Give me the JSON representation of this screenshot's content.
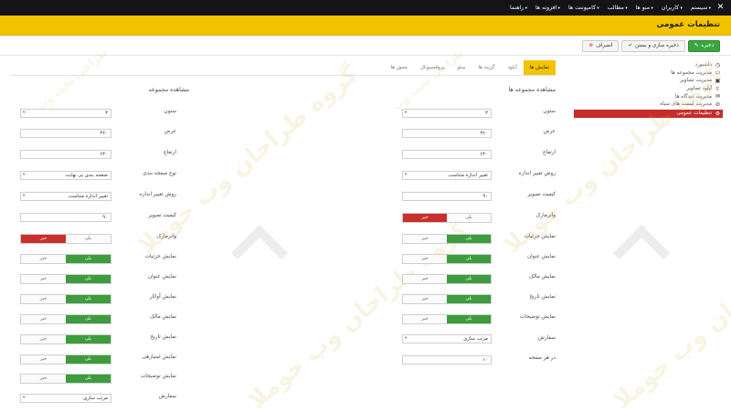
{
  "topbar": {
    "menu": [
      "سیستم",
      "کاربران",
      "منو ها",
      "مطالب",
      "کامپوننت ها",
      "افزونه ها",
      "راهنما"
    ]
  },
  "page": {
    "title": "تنظیمات عمومی"
  },
  "toolbar": {
    "save": "ذخیره",
    "save_close": "ذخیره سازی و بستن",
    "cancel": "انصراف"
  },
  "sidebar": {
    "items": [
      {
        "icon": "dashboard-icon",
        "label": "داشبورد"
      },
      {
        "icon": "folder-icon",
        "label": "مدیریت مجموعه ها"
      },
      {
        "icon": "images-icon",
        "label": "مدیریت تصاویر"
      },
      {
        "icon": "upload-icon",
        "label": "آپلود تصاویر"
      },
      {
        "icon": "comments-icon",
        "label": "مدیریت دیدگاه ها"
      },
      {
        "icon": "ban-icon",
        "label": "مدیریت لیست های سیاه"
      },
      {
        "icon": "settings-icon",
        "label": "تنظیمات عمومی"
      }
    ]
  },
  "tabs": [
    "نمایش ها",
    "آپلود",
    "گزینه ها",
    "سئو",
    "پروفسیونال",
    "مجوز ها"
  ],
  "left_col": {
    "heading": "مشاهده مجموعه",
    "fields": {
      "columns": {
        "label": "ستون",
        "value": "۳"
      },
      "width": {
        "label": "عرض",
        "value": "۳۶۰"
      },
      "height": {
        "label": "ارتفاع",
        "value": "۶۴۰"
      },
      "pagination": {
        "label": "نوع صفحه بندی",
        "value": "صفحه بندی بی نهایت"
      },
      "resize": {
        "label": "روش تغییر اندازه",
        "value": "تغییر اندازه متناسب"
      },
      "quality": {
        "label": "کیفیت تصویر",
        "value": "۹۰"
      },
      "watermark": {
        "label": "واترمارک",
        "yes": "بلی",
        "no": "خیر"
      },
      "details": {
        "label": "نمایش جزئیات",
        "yes": "بلی",
        "no": "خیر"
      },
      "title": {
        "label": "نمایش عنوان",
        "yes": "بلی",
        "no": "خیر"
      },
      "avatar": {
        "label": "نمایش آواتار",
        "yes": "بلی",
        "no": "خیر"
      },
      "owner": {
        "label": "نمایش مالک",
        "yes": "بلی",
        "no": "خیر"
      },
      "date": {
        "label": "نمایش تاریخ",
        "yes": "بلی",
        "no": "خیر"
      },
      "rating": {
        "label": "نمایش امتیازهی",
        "yes": "بلی",
        "no": "خیر"
      },
      "description": {
        "label": "نمایش توضیحات",
        "yes": "بلی",
        "no": "خیر"
      },
      "order": {
        "label": "سفارش",
        "value": "مرتب سازی"
      }
    }
  },
  "right_col": {
    "heading": "مشاهده مجموعه ها",
    "fields": {
      "columns": {
        "label": "ستون",
        "value": "۳"
      },
      "width": {
        "label": "عرض",
        "value": "۳۶۰"
      },
      "height": {
        "label": "ارتفاع",
        "value": "۶۴۰"
      },
      "resize": {
        "label": "روش تغییر اندازه",
        "value": "تغییر اندازه متناسب"
      },
      "quality": {
        "label": "کیفیت تصویر",
        "value": "۹۰"
      },
      "watermark": {
        "label": "واترمارک",
        "yes": "بلی",
        "no": "خیر"
      },
      "details": {
        "label": "نمایش جزئیات",
        "yes": "بلی",
        "no": "خیر"
      },
      "title": {
        "label": "نمایش عنوان",
        "yes": "بلی",
        "no": "خیر"
      },
      "owner": {
        "label": "نمایش مالک",
        "yes": "بلی",
        "no": "خیر"
      },
      "date": {
        "label": "نمایش تاریخ",
        "yes": "بلی",
        "no": "خیر"
      },
      "description": {
        "label": "نمایش توضیحات",
        "yes": "بلی",
        "no": "خیر"
      },
      "order": {
        "label": "سفارش",
        "value": "مرتب سازی"
      },
      "per_page": {
        "label": "در هر صفحه",
        "value": "۱۰"
      }
    }
  },
  "watermark_text": {
    "brand": "گروه طراحان وب جوملا",
    "sub": "طراحی تحت وب"
  },
  "colors": {
    "accent": "#f3c300",
    "topbar": "#141414",
    "green": "#3d9c3d",
    "red": "#c9302c"
  }
}
